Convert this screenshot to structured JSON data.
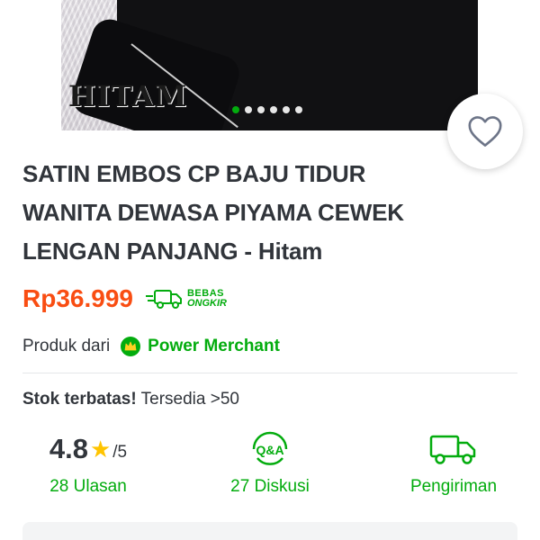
{
  "product_image": {
    "color_label": "HITAM",
    "carousel_count": 6,
    "carousel_active": 0
  },
  "product": {
    "title": "SATIN EMBOS CP BAJU TIDUR WANITA DEWASA PIYAMA CEWEK LENGAN PANJANG - Hitam",
    "price": "Rp36.999",
    "free_shipping_line1": "BEBAS",
    "free_shipping_line2": "ONGKIR"
  },
  "merchant": {
    "prefix": "Produk dari",
    "badge_icon": "power-merchant-crown-icon",
    "name": "Power Merchant"
  },
  "stock": {
    "emphasis": "Stok terbatas!",
    "detail": "Tersedia >50"
  },
  "stats": {
    "rating_value": "4.8",
    "rating_max": "/5",
    "reviews_label": "28 Ulasan",
    "qa_icon_text": "Q&A",
    "discussion_label": "27 Diskusi",
    "shipping_label": "Pengiriman"
  },
  "colors": {
    "brand_green": "#03ac0e",
    "price_orange": "#f94d12",
    "star_yellow": "#ffc400",
    "text_dark": "#31353b"
  }
}
